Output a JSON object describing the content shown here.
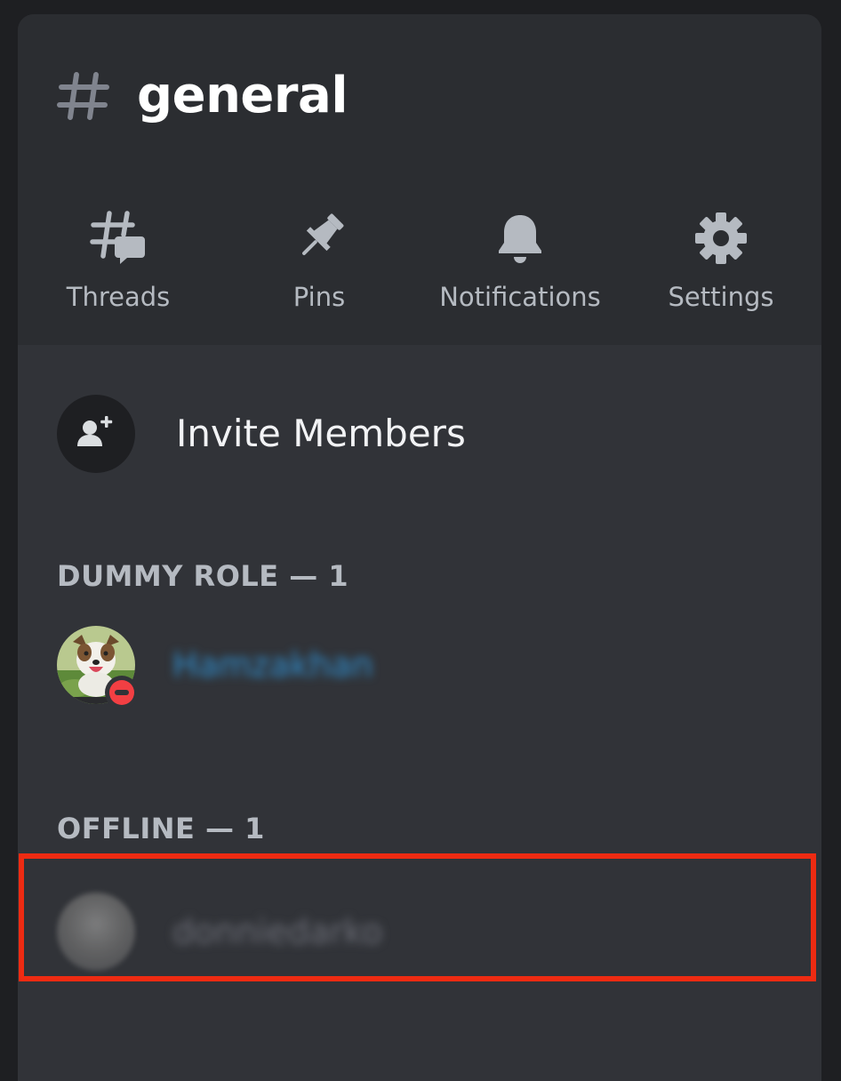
{
  "channel": {
    "name": "general"
  },
  "actions": [
    {
      "icon": "threads-icon",
      "label": "Threads"
    },
    {
      "icon": "pin-icon",
      "label": "Pins"
    },
    {
      "icon": "bell-icon",
      "label": "Notifications"
    },
    {
      "icon": "gear-icon",
      "label": "Settings"
    }
  ],
  "invite": {
    "icon": "add-user-icon",
    "label": "Invite Members"
  },
  "sections": [
    {
      "header": "DUMMY ROLE — 1",
      "members": [
        {
          "name": "Hamzakhan",
          "status": "dnd"
        }
      ]
    },
    {
      "header": "OFFLINE — 1",
      "members": [
        {
          "name": "donniedarko",
          "status": "offline"
        }
      ]
    }
  ],
  "colors": {
    "panel": "#2b2d31",
    "members_bg": "#313338",
    "highlight": "#ee2b12",
    "dnd": "#f23f43",
    "role_name": "#2f8fd0"
  }
}
